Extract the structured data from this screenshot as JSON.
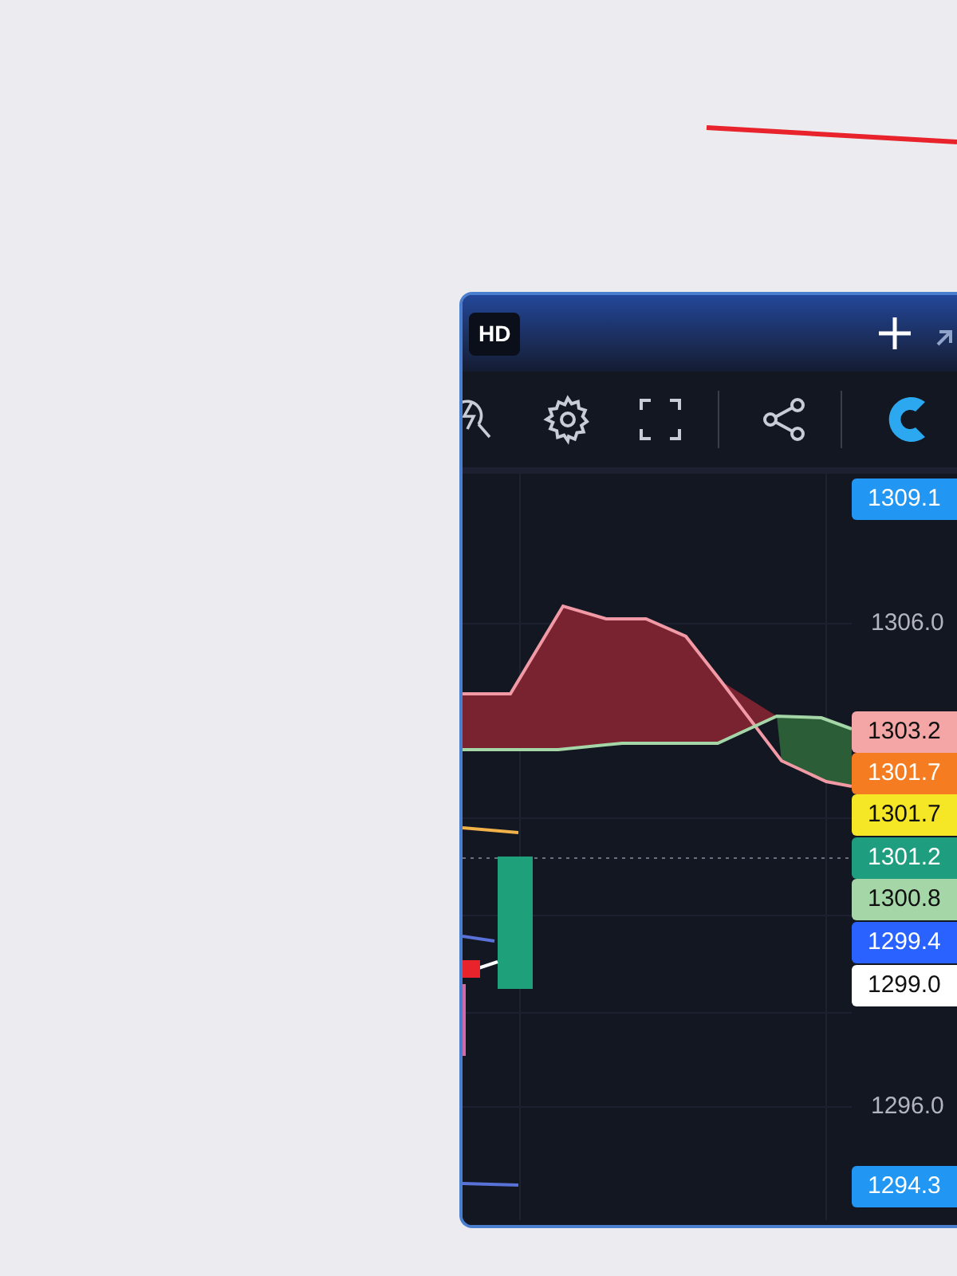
{
  "window": {
    "badge": "HD"
  },
  "price_axis": [
    {
      "kind": "tag",
      "text": "1309.1",
      "color": "#2196f3"
    },
    {
      "kind": "tick",
      "text": "1306.0"
    },
    {
      "kind": "tag",
      "text": "1303.2",
      "color": "#f4a6a6"
    },
    {
      "kind": "tag",
      "text": "1301.7",
      "color": "#f57c20"
    },
    {
      "kind": "tag",
      "text": "1301.7",
      "color": "#f5e626"
    },
    {
      "kind": "tag",
      "text": "1301.2",
      "color": "#1e9e7e"
    },
    {
      "kind": "tag",
      "text": "1300.8",
      "color": "#a5d6a7"
    },
    {
      "kind": "tag",
      "text": "1299.4",
      "color": "#2962ff"
    },
    {
      "kind": "tag",
      "text": "1299.0",
      "color": "#ffffff"
    },
    {
      "kind": "tick",
      "text": "1296.0"
    },
    {
      "kind": "tag",
      "text": "1294.3",
      "color": "#2196f3"
    }
  ]
}
